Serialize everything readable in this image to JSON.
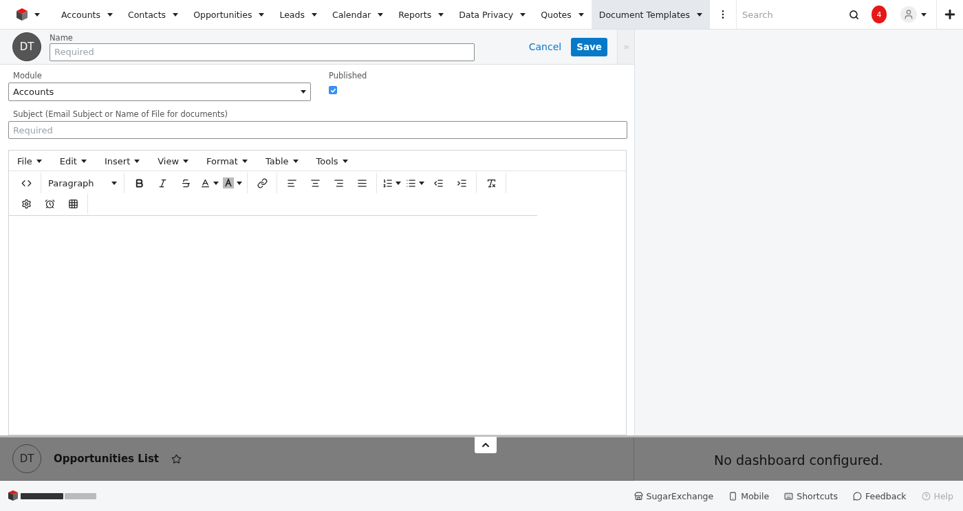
{
  "nav": {
    "items": [
      {
        "label": "Accounts",
        "selected": false
      },
      {
        "label": "Contacts",
        "selected": false
      },
      {
        "label": "Opportunities",
        "selected": false
      },
      {
        "label": "Leads",
        "selected": false
      },
      {
        "label": "Calendar",
        "selected": false
      },
      {
        "label": "Reports",
        "selected": false
      },
      {
        "label": "Data Privacy",
        "selected": false
      },
      {
        "label": "Quotes",
        "selected": false
      },
      {
        "label": "Document Templates",
        "selected": true
      }
    ],
    "search": {
      "placeholder": "Search"
    },
    "notifications": "4"
  },
  "record": {
    "avatar": "DT",
    "name": {
      "label": "Name",
      "placeholder": "Required"
    },
    "cancel": "Cancel",
    "save": "Save"
  },
  "form": {
    "module": {
      "label": "Module",
      "value": "Accounts"
    },
    "published": {
      "label": "Published",
      "checked": true
    },
    "subject": {
      "label": "Subject (Email Subject or Name of File for documents)",
      "placeholder": "Required"
    }
  },
  "editor": {
    "menus": [
      "File",
      "Edit",
      "Insert",
      "View",
      "Format",
      "Table",
      "Tools"
    ],
    "block_format": "Paragraph"
  },
  "drawer": {
    "avatar": "DT",
    "title": "Opportunities List",
    "favorite": false
  },
  "dashboard": {
    "message": "No dashboard configured."
  },
  "footer": {
    "links": [
      {
        "kind": "store",
        "label": "SugarExchange",
        "disabled": false
      },
      {
        "kind": "mobile",
        "label": "Mobile",
        "disabled": false
      },
      {
        "kind": "keyboard",
        "label": "Shortcuts",
        "disabled": false
      },
      {
        "kind": "chat",
        "label": "Feedback",
        "disabled": false
      },
      {
        "kind": "help",
        "label": "Help",
        "disabled": true
      }
    ]
  }
}
